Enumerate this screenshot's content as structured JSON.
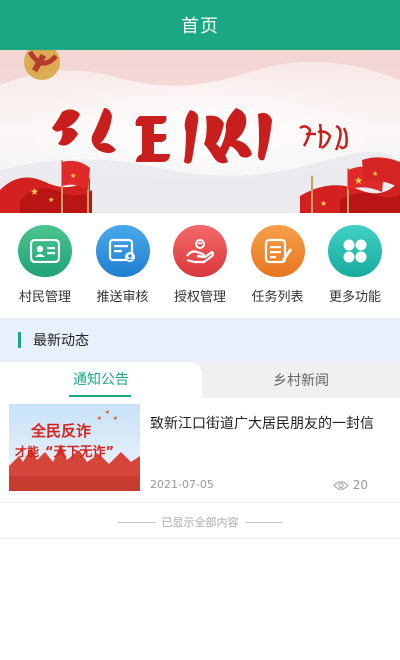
{
  "header": {
    "title": "首页"
  },
  "banner": {
    "slogan": "为人民服务",
    "signature": "毛泽东"
  },
  "menu": {
    "items": [
      {
        "label": "村民管理",
        "icon": "id-card-icon",
        "color": "#2fb27d"
      },
      {
        "label": "推送审核",
        "icon": "review-document-icon",
        "color": "#2c8fdd"
      },
      {
        "label": "授权管理",
        "icon": "authorization-hand-icon",
        "color": "#e44a4e"
      },
      {
        "label": "任务列表",
        "icon": "task-list-icon",
        "color": "#f08a33"
      },
      {
        "label": "更多功能",
        "icon": "more-grid-icon",
        "color": "#26bcb0"
      }
    ]
  },
  "section": {
    "title": "最新动态",
    "accent": "#1aa784"
  },
  "tabs": [
    {
      "label": "通知公告",
      "active": true
    },
    {
      "label": "乡村新闻",
      "active": false
    }
  ],
  "news": {
    "items": [
      {
        "title": "致新江口街道广大居民朋友的一封信",
        "date": "2021-07-05",
        "views": "20",
        "thumb_line1": "全民反诈",
        "thumb_line2_a": "才能",
        "thumb_line2_b": "“天下无诈”"
      }
    ]
  },
  "footer": {
    "end_text": "已显示全部内容"
  }
}
